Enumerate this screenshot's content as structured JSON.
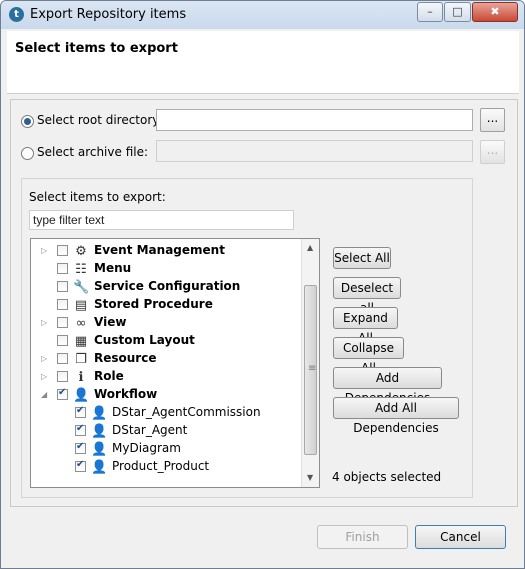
{
  "window": {
    "title": "Export Repository items",
    "icon": "talend-icon",
    "controls": {
      "minimize": "–",
      "maximize": "□",
      "close": "✖"
    }
  },
  "header": {
    "title": "Select items to export"
  },
  "source": {
    "root_directory_label": "Select root directory:",
    "root_directory_value": "",
    "root_selected": true,
    "archive_label": "Select archive file:",
    "archive_value": "",
    "archive_selected": false,
    "browse_label": "..."
  },
  "items_section": {
    "label": "Select items to export:",
    "filter_value": "type filter text"
  },
  "tree": [
    {
      "label": "Event Management",
      "bold": true,
      "expandable": true,
      "expanded": false,
      "checked": false,
      "level": 0,
      "icon": "gear-icon"
    },
    {
      "label": "Menu",
      "bold": true,
      "expandable": false,
      "expanded": false,
      "checked": false,
      "level": 0,
      "icon": "document-icon"
    },
    {
      "label": "Service Configuration",
      "bold": true,
      "expandable": false,
      "expanded": false,
      "checked": false,
      "level": 0,
      "icon": "wrench-icon"
    },
    {
      "label": "Stored Procedure",
      "bold": true,
      "expandable": false,
      "expanded": false,
      "checked": false,
      "level": 0,
      "icon": "stored-procedure-icon"
    },
    {
      "label": "View",
      "bold": true,
      "expandable": true,
      "expanded": false,
      "checked": false,
      "level": 0,
      "icon": "glasses-icon"
    },
    {
      "label": "Custom Layout",
      "bold": true,
      "expandable": false,
      "expanded": false,
      "checked": false,
      "level": 0,
      "icon": "layout-icon"
    },
    {
      "label": "Resource",
      "bold": true,
      "expandable": true,
      "expanded": false,
      "checked": false,
      "level": 0,
      "icon": "resource-icon"
    },
    {
      "label": "Role",
      "bold": true,
      "expandable": true,
      "expanded": false,
      "checked": false,
      "level": 0,
      "icon": "role-icon"
    },
    {
      "label": "Workflow",
      "bold": true,
      "expandable": true,
      "expanded": true,
      "checked": true,
      "level": 0,
      "icon": "user-icon"
    },
    {
      "label": "DStar_AgentCommission",
      "bold": false,
      "expandable": false,
      "expanded": false,
      "checked": true,
      "level": 1,
      "icon": "user-icon"
    },
    {
      "label": "DStar_Agent",
      "bold": false,
      "expandable": false,
      "expanded": false,
      "checked": true,
      "level": 1,
      "icon": "user-icon"
    },
    {
      "label": "MyDiagram",
      "bold": false,
      "expandable": false,
      "expanded": false,
      "checked": true,
      "level": 1,
      "icon": "user-icon"
    },
    {
      "label": "Product_Product",
      "bold": false,
      "expandable": false,
      "expanded": false,
      "checked": true,
      "level": 1,
      "icon": "user-icon"
    }
  ],
  "actions": {
    "select_all": "Select All",
    "deselect_all": "Deselect all",
    "expand_all": "Expand All",
    "collapse_all": "Collapse All",
    "add_dependencies": "Add Dependencies",
    "add_all_dependencies": "Add All Dependencies"
  },
  "status_text": "4 objects selected",
  "footer": {
    "finish": "Finish",
    "cancel": "Cancel",
    "finish_enabled": false
  }
}
